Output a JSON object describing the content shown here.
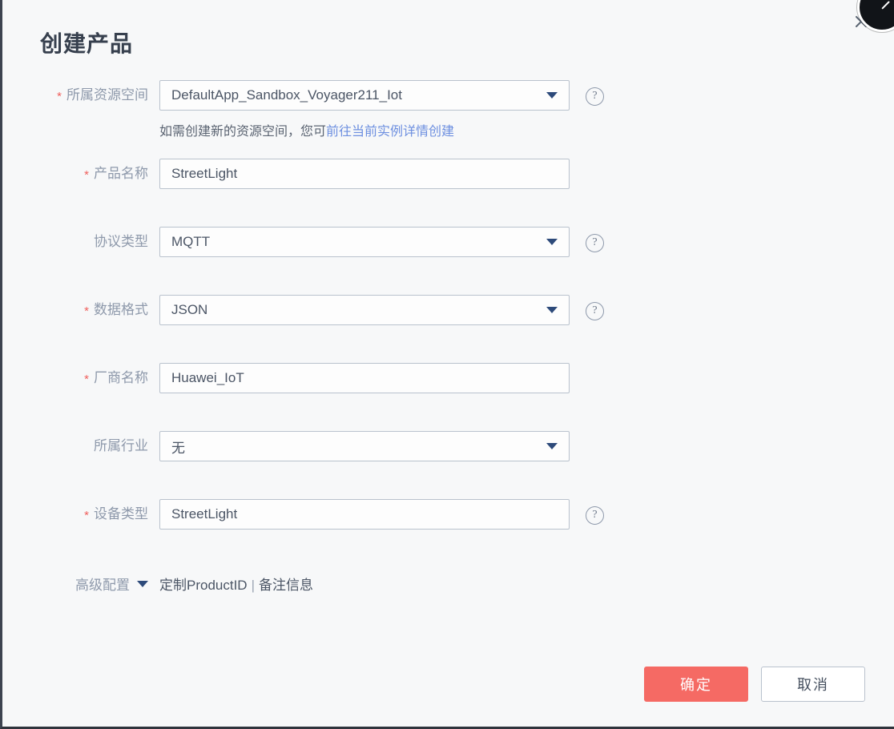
{
  "dialog": {
    "title": "创建产品",
    "close_icon": "close-icon",
    "corner_cursor_badge": "cursor-badge"
  },
  "colors": {
    "primary_button": "#f56a64",
    "required_star": "#f0605d",
    "link": "#6d8fe0",
    "label_text": "#8e99ab",
    "dialog_background": "#f7f8f9"
  },
  "form": {
    "resource_space": {
      "label": "所属资源空间",
      "required_marker": "*",
      "value": "DefaultApp_Sandbox_Voyager211_Iot",
      "caret_icon": "chevron-down-icon",
      "help_icon": "question-mark-icon",
      "help_glyph": "?",
      "hint_prefix": "如需创建新的资源空间，您可",
      "hint_link": "前往当前实例详情创建"
    },
    "product_name": {
      "label": "产品名称",
      "required_marker": "*",
      "value": "StreetLight",
      "placeholder": "StreetLight"
    },
    "protocol_type": {
      "label": "协议类型",
      "required_marker": "",
      "value": "MQTT",
      "caret_icon": "chevron-down-icon",
      "help_glyph": "?"
    },
    "data_format": {
      "label": "数据格式",
      "required_marker": "*",
      "value": "JSON",
      "caret_icon": "chevron-down-icon",
      "help_glyph": "?"
    },
    "manufacturer_name": {
      "label": "厂商名称",
      "required_marker": "*",
      "value": "Huawei_IoT",
      "placeholder": "Huawei_IoT"
    },
    "industry": {
      "label": "所属行业",
      "required_marker": "",
      "value": "无",
      "caret_icon": "chevron-down-icon"
    },
    "device_type": {
      "label": "设备类型",
      "required_marker": "*",
      "value": "StreetLight",
      "placeholder": "StreetLight",
      "help_glyph": "?"
    },
    "advanced": {
      "label": "高级配置",
      "caret_icon": "chevron-down-icon",
      "link_product_id": "定制ProductID",
      "separator": "|",
      "link_remark": "备注信息"
    }
  },
  "footer": {
    "confirm_label": "确定",
    "cancel_label": "取消"
  }
}
